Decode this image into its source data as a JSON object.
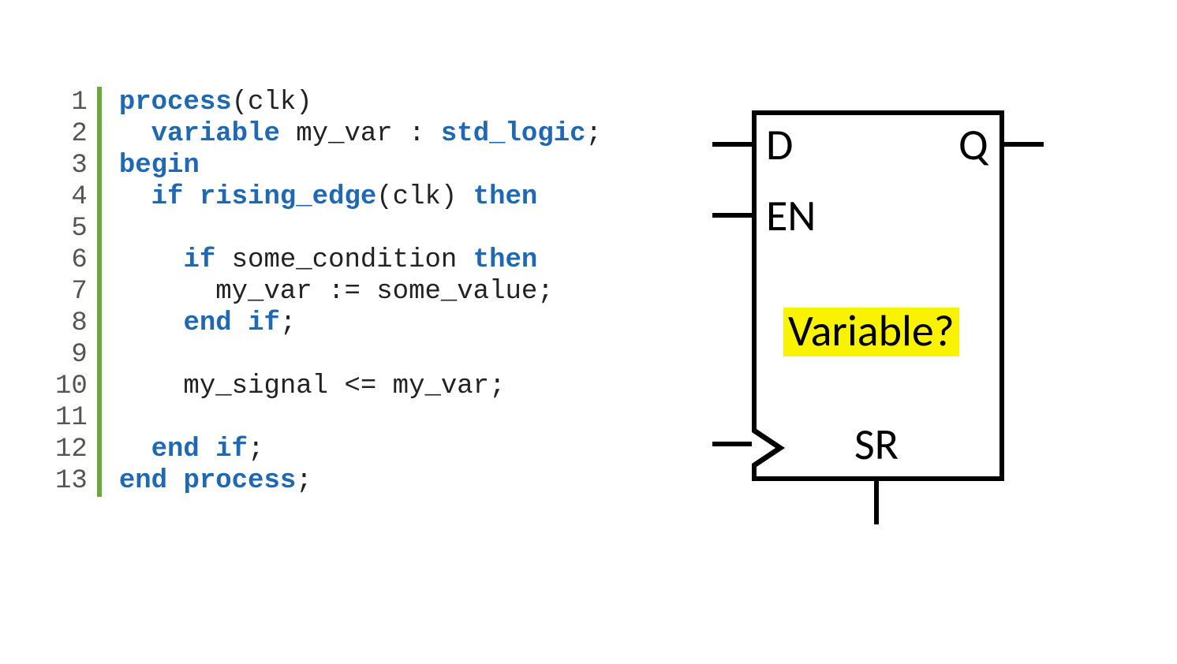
{
  "code": {
    "line_numbers": [
      "1",
      "2",
      "3",
      "4",
      "5",
      "6",
      "7",
      "8",
      "9",
      "10",
      "11",
      "12",
      "13"
    ],
    "lines": [
      [
        {
          "t": "process",
          "c": "kw"
        },
        {
          "t": "(clk)",
          "c": "plain"
        }
      ],
      [
        {
          "t": "  ",
          "c": "plain"
        },
        {
          "t": "variable",
          "c": "kw"
        },
        {
          "t": " my_var : ",
          "c": "plain"
        },
        {
          "t": "std_logic",
          "c": "type"
        },
        {
          "t": ";",
          "c": "plain"
        }
      ],
      [
        {
          "t": "begin",
          "c": "kw"
        }
      ],
      [
        {
          "t": "  ",
          "c": "plain"
        },
        {
          "t": "if",
          "c": "kw"
        },
        {
          "t": " ",
          "c": "plain"
        },
        {
          "t": "rising_edge",
          "c": "fn"
        },
        {
          "t": "(clk) ",
          "c": "plain"
        },
        {
          "t": "then",
          "c": "kw"
        }
      ],
      [
        {
          "t": "",
          "c": "plain"
        }
      ],
      [
        {
          "t": "    ",
          "c": "plain"
        },
        {
          "t": "if",
          "c": "kw"
        },
        {
          "t": " some_condition ",
          "c": "plain"
        },
        {
          "t": "then",
          "c": "kw"
        }
      ],
      [
        {
          "t": "      my_var := some_value;",
          "c": "plain"
        }
      ],
      [
        {
          "t": "    ",
          "c": "plain"
        },
        {
          "t": "end",
          "c": "kw"
        },
        {
          "t": " ",
          "c": "plain"
        },
        {
          "t": "if",
          "c": "kw"
        },
        {
          "t": ";",
          "c": "plain"
        }
      ],
      [
        {
          "t": "",
          "c": "plain"
        }
      ],
      [
        {
          "t": "    my_signal <= my_var;",
          "c": "plain"
        }
      ],
      [
        {
          "t": "",
          "c": "plain"
        }
      ],
      [
        {
          "t": "  ",
          "c": "plain"
        },
        {
          "t": "end",
          "c": "kw"
        },
        {
          "t": " ",
          "c": "plain"
        },
        {
          "t": "if",
          "c": "kw"
        },
        {
          "t": ";",
          "c": "plain"
        }
      ],
      [
        {
          "t": "end",
          "c": "kw"
        },
        {
          "t": " ",
          "c": "plain"
        },
        {
          "t": "process",
          "c": "kw"
        },
        {
          "t": ";",
          "c": "plain"
        }
      ]
    ]
  },
  "diagram": {
    "d_label": "D",
    "q_label": "Q",
    "en_label": "EN",
    "sr_label": "SR",
    "highlight": "Variable?"
  }
}
